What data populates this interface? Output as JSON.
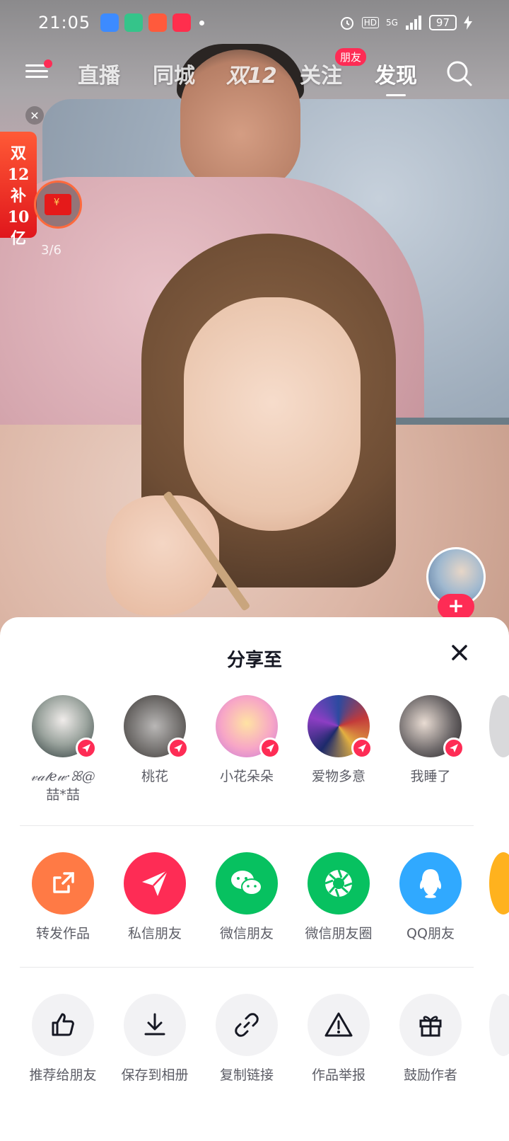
{
  "status_bar": {
    "time": "21:05",
    "indicators": [
      "alarm-icon",
      "HD",
      "5G",
      "signal-icon"
    ],
    "battery": "97"
  },
  "top_nav": {
    "tabs": [
      "直播",
      "同城",
      "双12",
      "关注",
      "发现"
    ],
    "active_tab": "发现",
    "badge": "朋友"
  },
  "promo": {
    "banner_lines": [
      "双12",
      "补",
      "10",
      "亿"
    ],
    "count": "3/6"
  },
  "share_sheet": {
    "title": "分享至",
    "contacts": [
      {
        "name": "𝓋𝒶𝓉𝑒𝓌·ꕤ@\n喆*喆",
        "line1": "𝓋𝒶𝓉𝑒𝓌·ꕤ@",
        "line2": "喆*喆"
      },
      {
        "name": "桃花"
      },
      {
        "name": "小花朵朵"
      },
      {
        "name": "爱物多意"
      },
      {
        "name": "我睡了"
      }
    ],
    "share_targets": [
      {
        "label": "转发作品",
        "icon": "forward-icon",
        "color": "#ff7a45"
      },
      {
        "label": "私信朋友",
        "icon": "send-icon",
        "color": "#fe2c55"
      },
      {
        "label": "微信朋友",
        "icon": "wechat-icon",
        "color": "#07c160"
      },
      {
        "label": "微信朋友圈",
        "icon": "moments-icon",
        "color": "#07c160"
      },
      {
        "label": "QQ朋友",
        "icon": "qq-icon",
        "color": "#30a9ff"
      }
    ],
    "actions": [
      {
        "label": "推荐给朋友",
        "icon": "thumbs-up-icon"
      },
      {
        "label": "保存到相册",
        "icon": "download-icon"
      },
      {
        "label": "复制链接",
        "icon": "link-icon"
      },
      {
        "label": "作品举报",
        "icon": "warning-icon"
      },
      {
        "label": "鼓励作者",
        "icon": "gift-icon"
      }
    ]
  }
}
